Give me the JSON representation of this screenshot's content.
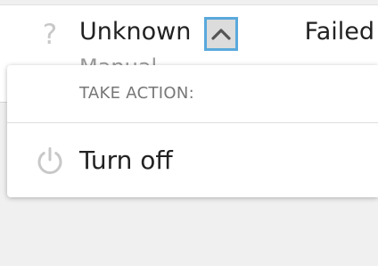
{
  "row": {
    "status_icon": "question-mark-icon",
    "status_icon_glyph": "?",
    "status_label": "Unknown",
    "sub_label": "Manual",
    "toggle_icon": "chevron-up-icon",
    "result_label": "Failed"
  },
  "menu": {
    "heading": "TAKE ACTION:",
    "items": [
      {
        "label": "Turn off",
        "icon": "power-icon"
      }
    ]
  },
  "colors": {
    "focus_outline": "#5aa9dc",
    "icon_gray": "#c8c8c8",
    "page_background": "#f0f0f0"
  }
}
